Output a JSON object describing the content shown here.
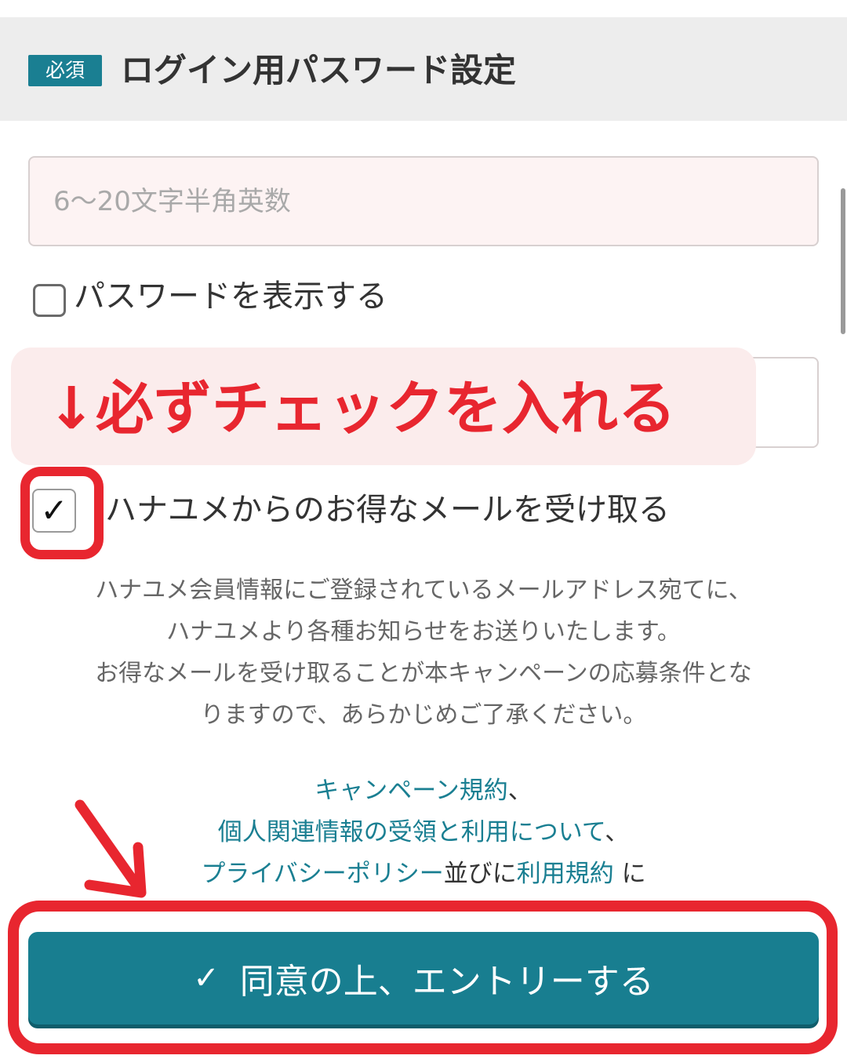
{
  "header": {
    "required_badge": "必須",
    "title": "ログイン用パスワード設定"
  },
  "password": {
    "placeholder": "6〜20文字半角英数",
    "value": ""
  },
  "show_password": {
    "label": "パスワードを表示する",
    "checked": false
  },
  "callout": {
    "text": "↓必ずチェックを入れる"
  },
  "mail_optin": {
    "label": "ハナユメからのお得なメールを受け取る",
    "checked": true,
    "check_glyph": "✓"
  },
  "notice": {
    "lines": [
      "ハナユメ会員情報にご登録されているメールアドレス宛てに、",
      "ハナユメより各種お知らせをお送りいたします。",
      "お得なメールを受け取ることが本キャンペーンの応募条件とな",
      "りますので、あらかじめご了承ください。"
    ]
  },
  "links": {
    "campaign_terms": "キャンペーン規約",
    "sep1": "、",
    "personal_info": "個人関連情報の受領と利用について",
    "sep2": "、",
    "privacy_policy": "プライバシーポリシー",
    "and_text": "並びに",
    "terms_of_use": "利用規約",
    "suffix": " に"
  },
  "submit": {
    "icon": "✓",
    "label": "同意の上、エントリーする"
  },
  "colors": {
    "accent": "#187e90",
    "annotation_red": "#e8262f",
    "input_bg": "#fdf3f3",
    "header_bg": "#ededed"
  }
}
